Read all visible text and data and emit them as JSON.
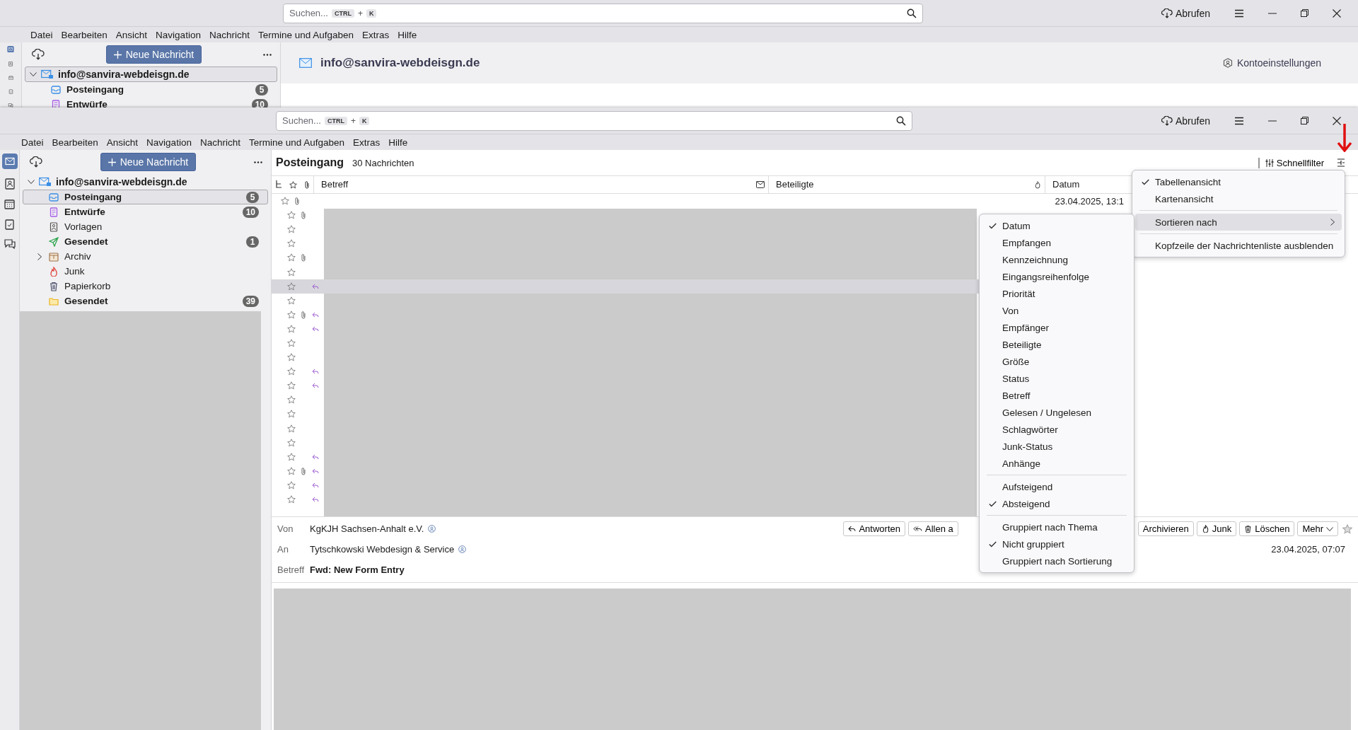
{
  "back_window": {
    "search": {
      "placeholder": "Suchen...",
      "keys": [
        "CTRL",
        "K"
      ],
      "joiner": "+"
    },
    "fetch": "Abrufen",
    "menu": [
      "Datei",
      "Bearbeiten",
      "Ansicht",
      "Navigation",
      "Nachricht",
      "Termine und Aufgaben",
      "Extras",
      "Hilfe"
    ],
    "new_message": "Neue Nachricht",
    "account": {
      "name": "info@sanvira-webdeisgn.de",
      "expanded": true,
      "selected": true,
      "folders": [
        {
          "kind": "inbox",
          "name": "Posteingang",
          "count": "5",
          "unread": true,
          "selected": false,
          "collapsed": false
        },
        {
          "kind": "drafts",
          "name": "Entwürfe",
          "count": "10",
          "unread": true,
          "selected": false,
          "collapsed": false
        }
      ]
    },
    "account_header": "info@sanvira-webdeisgn.de",
    "account_settings": "Kontoeinstellungen"
  },
  "front_window": {
    "search": {
      "placeholder": "Suchen...",
      "keys": [
        "CTRL",
        "K"
      ],
      "joiner": "+"
    },
    "fetch": "Abrufen",
    "menu": [
      "Datei",
      "Bearbeiten",
      "Ansicht",
      "Navigation",
      "Nachricht",
      "Termine und Aufgaben",
      "Extras",
      "Hilfe"
    ],
    "new_message": "Neue Nachricht",
    "account": {
      "name": "info@sanvira-webdeisgn.de",
      "expanded": true,
      "selected": false,
      "folders": [
        {
          "kind": "inbox",
          "name": "Posteingang",
          "count": "5",
          "unread": true,
          "selected": true,
          "collapsed": false
        },
        {
          "kind": "drafts",
          "name": "Entwürfe",
          "count": "10",
          "unread": true,
          "selected": false,
          "collapsed": false
        },
        {
          "kind": "templates",
          "name": "Vorlagen",
          "unread": false,
          "selected": false,
          "collapsed": false
        },
        {
          "kind": "sent",
          "name": "Gesendet",
          "count": "1",
          "unread": true,
          "selected": false,
          "collapsed": false
        },
        {
          "kind": "archive",
          "name": "Archiv",
          "unread": false,
          "selected": false,
          "collapsed": true
        },
        {
          "kind": "junk",
          "name": "Junk",
          "unread": false,
          "selected": false,
          "collapsed": false
        },
        {
          "kind": "trash",
          "name": "Papierkorb",
          "unread": false,
          "selected": false,
          "collapsed": false
        },
        {
          "kind": "folder",
          "name": "Gesendet",
          "count": "39",
          "unread": true,
          "selected": false,
          "collapsed": false
        }
      ]
    },
    "list": {
      "title": "Posteingang",
      "count": "30 Nachrichten",
      "quick_filter": "Schnellfilter",
      "columns": [
        {
          "kind": "thread"
        },
        {
          "kind": "star"
        },
        {
          "kind": "attachment"
        },
        {
          "kind": "text",
          "label": "Betreff"
        },
        {
          "kind": "status"
        },
        {
          "kind": "text",
          "label": "Beteiligte"
        },
        {
          "kind": "junk"
        },
        {
          "kind": "text",
          "label": "Datum"
        }
      ],
      "rows": [
        {
          "attachment": true,
          "replied": false,
          "selected": false,
          "date": "23.04.2025, 13:1"
        },
        {
          "attachment": true,
          "replied": false,
          "selected": false
        },
        {
          "attachment": false,
          "replied": false,
          "selected": false
        },
        {
          "attachment": false,
          "replied": false,
          "selected": false
        },
        {
          "attachment": true,
          "replied": false,
          "selected": false
        },
        {
          "attachment": false,
          "replied": false,
          "selected": false
        },
        {
          "attachment": false,
          "replied": true,
          "selected": true
        },
        {
          "attachment": false,
          "replied": false,
          "selected": false
        },
        {
          "attachment": true,
          "replied": true,
          "selected": false
        },
        {
          "attachment": false,
          "replied": true,
          "selected": false
        },
        {
          "attachment": false,
          "replied": false,
          "selected": false
        },
        {
          "attachment": false,
          "replied": false,
          "selected": false
        },
        {
          "attachment": false,
          "replied": true,
          "selected": false
        },
        {
          "attachment": false,
          "replied": true,
          "selected": false
        },
        {
          "attachment": false,
          "replied": false,
          "selected": false
        },
        {
          "attachment": false,
          "replied": false,
          "selected": false
        },
        {
          "attachment": false,
          "replied": false,
          "selected": false
        },
        {
          "attachment": false,
          "replied": false,
          "selected": false
        },
        {
          "attachment": false,
          "replied": true,
          "selected": false
        },
        {
          "attachment": true,
          "replied": true,
          "selected": false
        },
        {
          "attachment": false,
          "replied": true,
          "selected": false
        },
        {
          "attachment": false,
          "replied": true,
          "selected": false
        }
      ]
    },
    "preview": {
      "fields": [
        {
          "label": "Von",
          "value": "KgKJH Sachsen-Anhalt e.V.",
          "contact": true
        },
        {
          "label": "An",
          "value": "Tytschkowski Webdesign & Service",
          "contact": true
        },
        {
          "label": "Betreff",
          "value": "Fwd: New Form Entry",
          "contact": false
        }
      ],
      "date": "23.04.2025, 07:07",
      "buttons": [
        {
          "kind": "reply",
          "label": "Antworten"
        },
        {
          "kind": "reply-all",
          "label": "Allen a"
        },
        {
          "kind": "plain",
          "label": "Archivieren"
        },
        {
          "kind": "junk",
          "label": "Junk"
        },
        {
          "kind": "trash",
          "label": "Löschen"
        },
        {
          "kind": "dropdown",
          "label": "Mehr"
        }
      ]
    },
    "view_menu": [
      {
        "kind": "item",
        "label": "Tabellenansicht",
        "checked": true,
        "selected": false
      },
      {
        "kind": "item",
        "label": "Kartenansicht",
        "checked": false,
        "selected": false
      },
      {
        "kind": "separator"
      },
      {
        "kind": "submenu",
        "label": "Sortieren nach",
        "checked": false,
        "selected": true
      },
      {
        "kind": "separator"
      },
      {
        "kind": "item",
        "label": "Kopfzeile der Nachrichtenliste ausblenden",
        "checked": false,
        "selected": false
      }
    ],
    "sort_menu": [
      {
        "kind": "item",
        "label": "Datum",
        "checked": true
      },
      {
        "kind": "item",
        "label": "Empfangen",
        "checked": false
      },
      {
        "kind": "item",
        "label": "Kennzeichnung",
        "checked": false
      },
      {
        "kind": "item",
        "label": "Eingangsreihenfolge",
        "checked": false
      },
      {
        "kind": "item",
        "label": "Priorität",
        "checked": false
      },
      {
        "kind": "item",
        "label": "Von",
        "checked": false
      },
      {
        "kind": "item",
        "label": "Empfänger",
        "checked": false
      },
      {
        "kind": "item",
        "label": "Beteiligte",
        "checked": false
      },
      {
        "kind": "item",
        "label": "Größe",
        "checked": false
      },
      {
        "kind": "item",
        "label": "Status",
        "checked": false
      },
      {
        "kind": "item",
        "label": "Betreff",
        "checked": false
      },
      {
        "kind": "item",
        "label": "Gelesen / Ungelesen",
        "checked": false
      },
      {
        "kind": "item",
        "label": "Schlagwörter",
        "checked": false
      },
      {
        "kind": "item",
        "label": "Junk-Status",
        "checked": false
      },
      {
        "kind": "item",
        "label": "Anhänge",
        "checked": false
      },
      {
        "kind": "separator"
      },
      {
        "kind": "item",
        "label": "Aufsteigend",
        "checked": false
      },
      {
        "kind": "item",
        "label": "Absteigend",
        "checked": true
      },
      {
        "kind": "separator"
      },
      {
        "kind": "item",
        "label": "Gruppiert nach Thema",
        "checked": false
      },
      {
        "kind": "item",
        "label": "Nicht gruppiert",
        "checked": true
      },
      {
        "kind": "item",
        "label": "Gruppiert nach Sortierung",
        "checked": false
      }
    ]
  }
}
